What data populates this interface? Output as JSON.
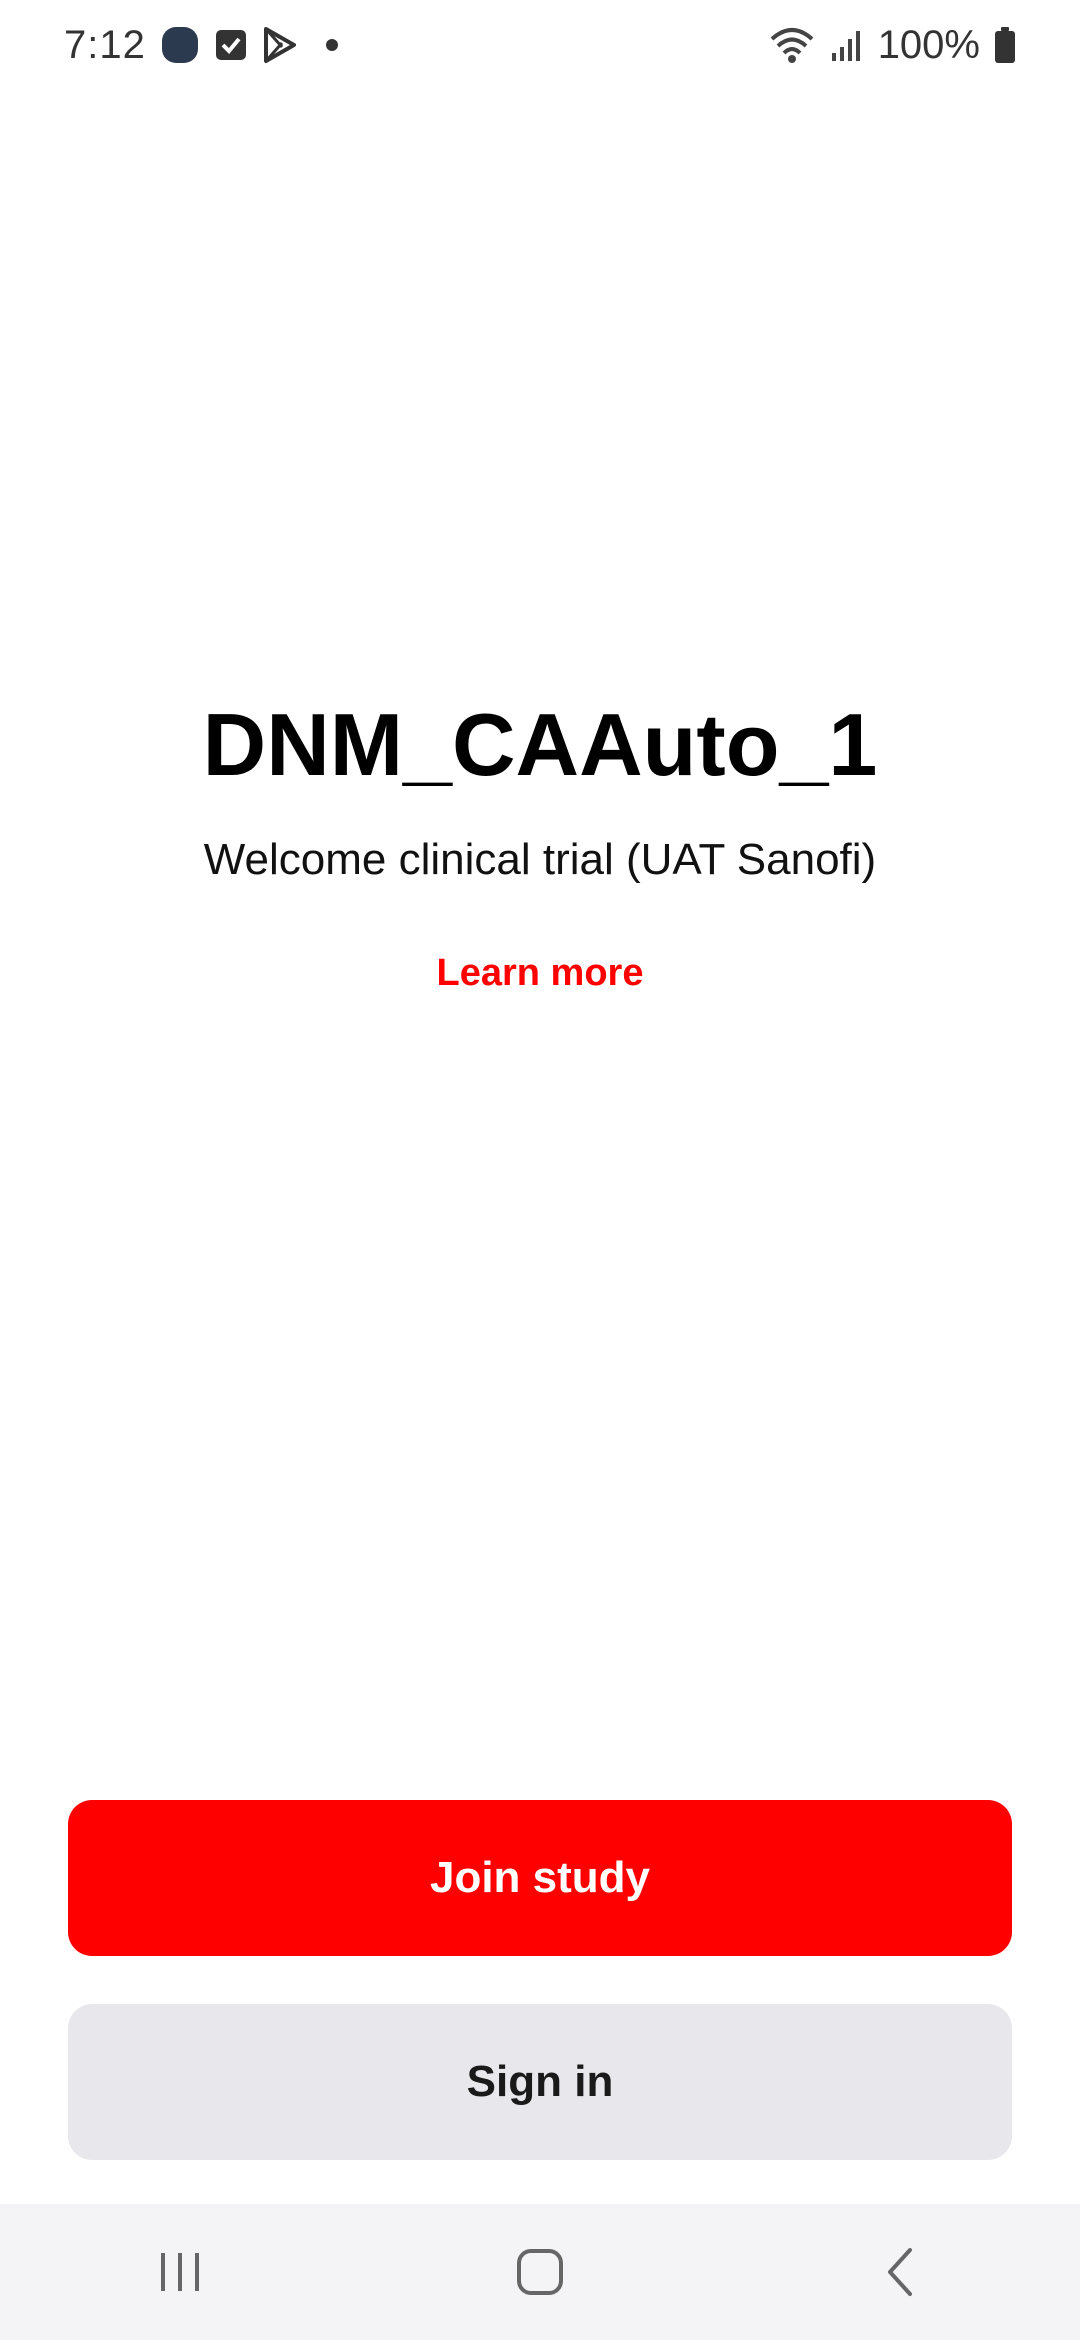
{
  "status_bar": {
    "time": "7:12",
    "battery": "100%",
    "icons": [
      "app-notification-icon",
      "checkbox-notification-icon",
      "play-store-icon",
      "notification-dot-icon",
      "wifi-icon",
      "signal-icon",
      "battery-icon"
    ]
  },
  "study": {
    "title": "DNM_CAAuto_1",
    "subtitle": "Welcome clinical trial (UAT Sanofi)",
    "learn_more": "Learn more"
  },
  "actions": {
    "join_label": "Join study",
    "signin_label": "Sign in"
  },
  "nav_bar": {
    "icons": [
      "recent-apps-icon",
      "home-icon",
      "back-icon"
    ]
  },
  "colors": {
    "accent": "#ff0000",
    "secondary_button": "#e8e8ec",
    "nav_background": "#f4f4f6"
  }
}
